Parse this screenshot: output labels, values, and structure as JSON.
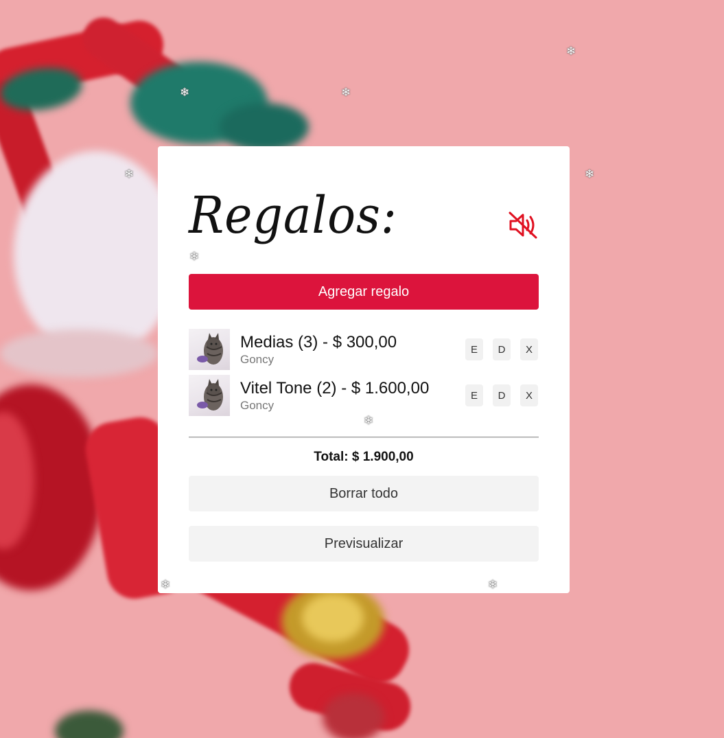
{
  "title": "Regalos:",
  "mute_icon": "speaker-muted-icon",
  "add_button": "Agregar regalo",
  "gifts": [
    {
      "name": "Medias (3) - $ 300,00",
      "recipient": "Goncy",
      "edit": "E",
      "duplicate": "D",
      "delete": "X"
    },
    {
      "name": "Vitel Tone (2) - $ 1.600,00",
      "recipient": "Goncy",
      "edit": "E",
      "duplicate": "D",
      "delete": "X"
    }
  ],
  "total": "Total: $ 1.900,00",
  "clear_button": "Borrar todo",
  "preview_button": "Previsualizar",
  "snowflake": "❄",
  "colors": {
    "accent": "#dc143c",
    "background": "#f0a8ab",
    "card": "#ffffff"
  }
}
